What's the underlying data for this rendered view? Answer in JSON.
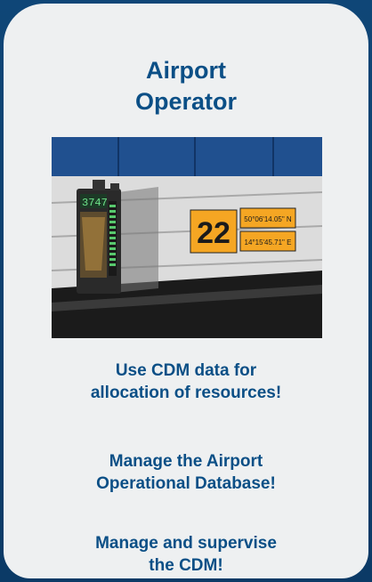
{
  "card": {
    "title": "Airport\nOperator"
  },
  "photo": {
    "icon": "airport-stand-sign-photo",
    "display_number": "3747",
    "stand_number": "22",
    "latitude": "50°06'14.05\" N",
    "longitude": "14°15'45.71\" E"
  },
  "bullets": [
    "Use CDM data for\nallocation of resources!",
    "Manage the Airport\nOperational Database!",
    "Manage and supervise\nthe CDM!"
  ]
}
